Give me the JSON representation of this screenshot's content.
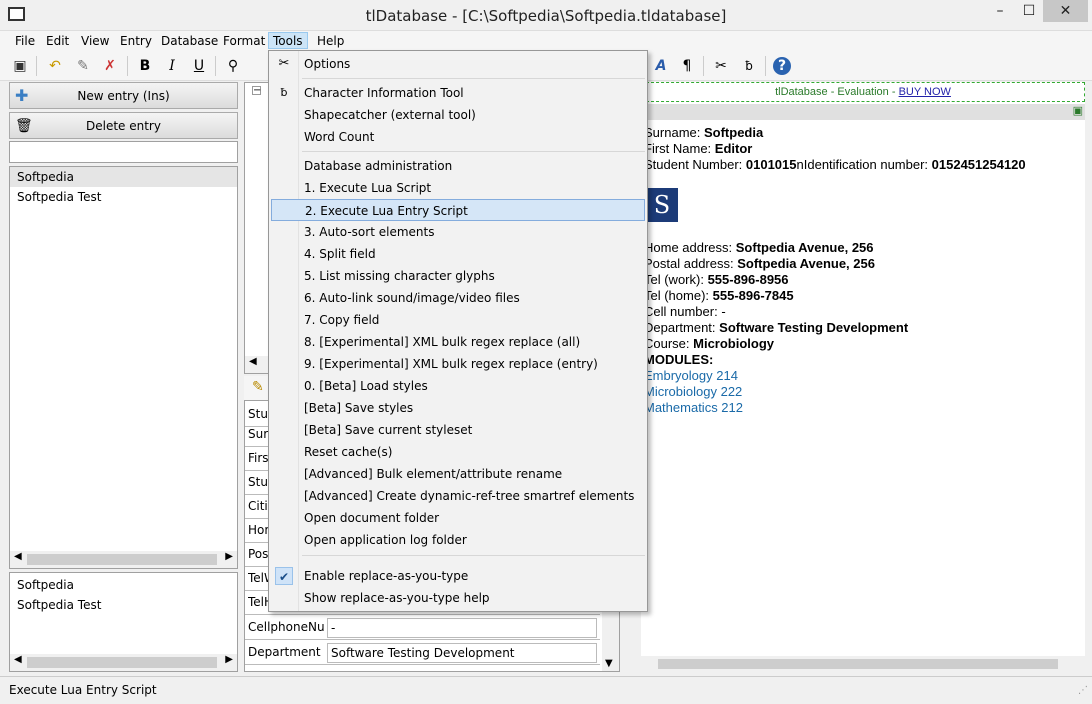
{
  "window": {
    "title": "tlDatabase - [C:\\Softpedia\\Softpedia.tldatabase]",
    "minimize": "–",
    "maximize": "☐",
    "close": "✕"
  },
  "menubar": [
    "File",
    "Edit",
    "View",
    "Entry",
    "Database",
    "Format",
    "Tools",
    "Help"
  ],
  "left": {
    "new_entry": "New entry (Ins)",
    "delete_entry": "Delete entry",
    "search_value": "",
    "entries": [
      "Softpedia",
      "Softpedia Test"
    ],
    "entries2": [
      "Softpedia",
      "Softpedia Test"
    ]
  },
  "fields": {
    "labels": [
      "Stud",
      "Surn",
      "First",
      "Stud",
      "Citiz",
      "Hom",
      "Post",
      "TelW",
      "TelH"
    ],
    "rows": [
      {
        "label": "CellphoneNum",
        "value": "-"
      },
      {
        "label": "Department",
        "value": "Software Testing Development"
      }
    ]
  },
  "tools_menu": {
    "items": [
      {
        "label": "Options",
        "icon": "scissors-icon",
        "glyph": "✂"
      },
      {
        "label": "Character Information Tool",
        "icon": "char-info-icon",
        "glyph": "ƀ"
      },
      {
        "label": "Shapecatcher (external tool)"
      },
      {
        "label": "Word Count"
      },
      {
        "label": "Database administration"
      },
      {
        "label": "1. Execute Lua Script"
      },
      {
        "label": "2. Execute Lua Entry Script"
      },
      {
        "label": "3. Auto-sort elements"
      },
      {
        "label": "4. Split field"
      },
      {
        "label": "5. List missing character glyphs"
      },
      {
        "label": "6. Auto-link sound/image/video files"
      },
      {
        "label": "7. Copy field"
      },
      {
        "label": "8. [Experimental] XML bulk regex replace (all)"
      },
      {
        "label": "9. [Experimental] XML bulk regex replace (entry)"
      },
      {
        "label": "0. [Beta] Load styles"
      },
      {
        "label": "[Beta] Save styles"
      },
      {
        "label": "[Beta] Save current styleset"
      },
      {
        "label": "Reset cache(s)"
      },
      {
        "label": "[Advanced] Bulk element/attribute rename"
      },
      {
        "label": "[Advanced] Create dynamic-ref-tree smartref elements"
      },
      {
        "label": "Open document folder"
      },
      {
        "label": "Open application log folder"
      },
      {
        "label": "Enable replace-as-you-type",
        "checked": true
      },
      {
        "label": "Show replace-as-you-type help"
      }
    ]
  },
  "preview": {
    "banner_text": "tlDatabase - Evaluation - ",
    "banner_link": "BUY NOW",
    "surname_label": "Surname: ",
    "surname": "Softpedia",
    "first_label": "First Name: ",
    "first": "Editor",
    "student_label": "Student Number: ",
    "student": "0101015",
    "id_label": "nIdentification number: ",
    "id": "0152451254120",
    "logo_letter": "S",
    "home_label": "Home address: ",
    "home": "Softpedia Avenue, 256",
    "postal_label": "Postal address: ",
    "postal": "Softpedia Avenue, 256",
    "telw_label": "Tel (work): ",
    "telw": "555-896-8956",
    "telh_label": "Tel (home): ",
    "telh": "555-896-7845",
    "cell_label": "Cell number: ",
    "cell": "-",
    "dept_label": "Department: ",
    "dept": "Software Testing Development",
    "course_label": "Course: ",
    "course": "Microbiology",
    "modules": "MODULES:",
    "module_links": [
      "Embryology 214",
      "Microbiology 222",
      "Mathematics 212"
    ]
  },
  "status": "Execute Lua Entry Script"
}
